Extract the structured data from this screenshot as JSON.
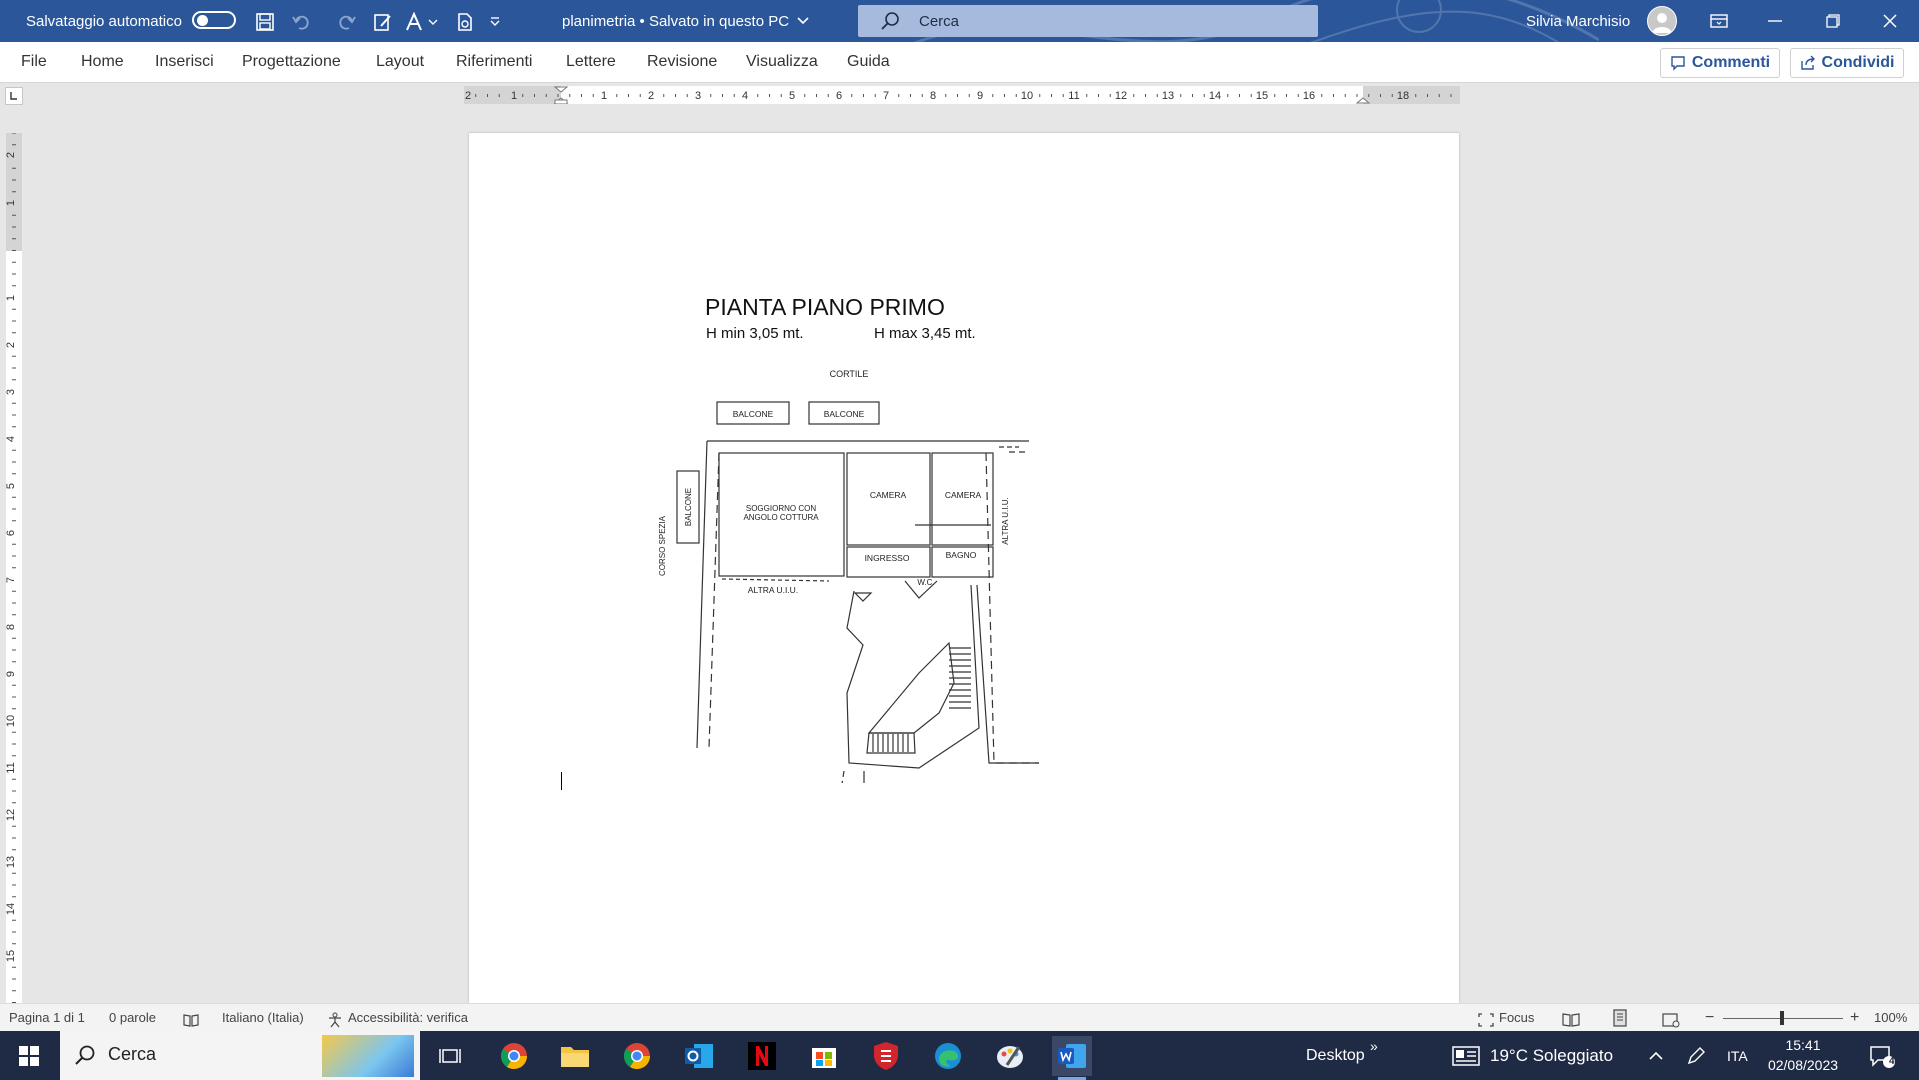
{
  "titlebar": {
    "autosave_label": "Salvataggio automatico",
    "doc_title": "planimetria • Salvato in questo PC",
    "search_placeholder": "Cerca",
    "user_name": "Silvia  Marchisio",
    "colors": {
      "bar": "#2b579a"
    }
  },
  "menu": {
    "tabs": [
      "File",
      "Home",
      "Inserisci",
      "Progettazione",
      "Layout",
      "Riferimenti",
      "Lettere",
      "Revisione",
      "Visualizza",
      "Guida"
    ],
    "comments_label": "Commenti",
    "share_label": "Condividi"
  },
  "rulers": {
    "horizontal": [
      "2",
      "1",
      "1",
      "2",
      "3",
      "4",
      "5",
      "6",
      "7",
      "8",
      "9",
      "10",
      "11",
      "12",
      "13",
      "14",
      "15",
      "16",
      "18"
    ],
    "vertical": [
      "2",
      "1",
      "1",
      "2",
      "3",
      "4",
      "5",
      "6",
      "7",
      "8",
      "9",
      "10",
      "11",
      "12",
      "13",
      "14",
      "15"
    ]
  },
  "document": {
    "title": "PIANTA PIANO PRIMO",
    "h_min": "H min 3,05 mt.",
    "h_max": "H max 3,45 mt.",
    "plan_labels": {
      "cortile": "CORTILE",
      "balcone1": "BALCONE",
      "balcone2": "BALCONE",
      "balcone_side": "BALCONE",
      "soggiorno1": "SOGGIORNO CON",
      "soggiorno2": "ANGOLO COTTURA",
      "camera1": "CAMERA",
      "camera2": "CAMERA",
      "ingresso": "INGRESSO",
      "bagno": "BAGNO",
      "wc": "W.C.",
      "altra_uiu_bottom": "ALTRA U.I.U.",
      "altra_uiu_right": "ALTRA U.I.U.",
      "corso": "CORSO SPEZIA"
    }
  },
  "statusbar": {
    "page": "Pagina 1 di 1",
    "words": "0 parole",
    "language": "Italiano (Italia)",
    "accessibility": "Accessibilità: verifica",
    "focus": "Focus",
    "zoom": "100%"
  },
  "taskbar": {
    "search": "Cerca",
    "desktop": "Desktop",
    "weather": "19°C  Soleggiato",
    "lang": "ITA",
    "time": "15:41",
    "date": "02/08/2023",
    "notif_count": "4"
  }
}
